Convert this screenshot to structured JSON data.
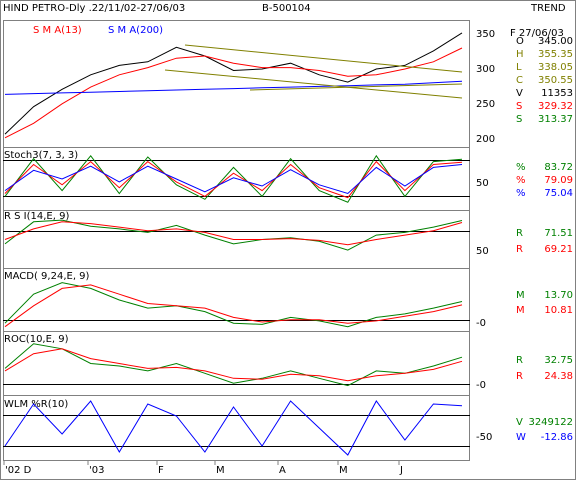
{
  "header": {
    "title": "HIND PETRO-Dly .22/11/02-27/06/03",
    "code": "B-500104",
    "trend_label": "TREND"
  },
  "price_panel": {
    "sma13_label": "S M A(13)",
    "sma200_label": "S M A(200)",
    "date_label": "F 27/06/03",
    "stats": [
      {
        "key": "O",
        "value": "345.00",
        "color": "#000000"
      },
      {
        "key": "H",
        "value": "355.35",
        "color": "#808000"
      },
      {
        "key": "L",
        "value": "338.05",
        "color": "#808000"
      },
      {
        "key": "C",
        "value": "350.55",
        "color": "#808000"
      },
      {
        "key": "V",
        "value": "11353",
        "color": "#000000"
      },
      {
        "key": "S",
        "value": "329.32",
        "color": "#ff0000"
      },
      {
        "key": "S",
        "value": "313.37",
        "color": "#008000"
      }
    ],
    "y_ticks": [
      "350",
      "300",
      "250",
      "200"
    ]
  },
  "stoch_panel": {
    "label": "Stoch3(7, 3, 3)",
    "stats": [
      {
        "key": "%",
        "value": "83.72",
        "color": "#008000"
      },
      {
        "key": "%",
        "value": "79.09",
        "color": "#ff0000"
      },
      {
        "key": "%",
        "value": "75.04",
        "color": "#0000ff"
      }
    ],
    "y_ticks": [
      "50"
    ]
  },
  "rsi_panel": {
    "label": "R S I(14,E, 9)",
    "stats": [
      {
        "key": "R",
        "value": "71.51",
        "color": "#008000"
      },
      {
        "key": "R",
        "value": "69.21",
        "color": "#ff0000"
      }
    ],
    "y_ticks": [
      "50"
    ]
  },
  "macd_panel": {
    "label": "MACD( 9,24,E, 9)",
    "stats": [
      {
        "key": "M",
        "value": "13.70",
        "color": "#008000"
      },
      {
        "key": "M",
        "value": "10.81",
        "color": "#ff0000"
      }
    ],
    "y_ticks": [
      "-0"
    ]
  },
  "roc_panel": {
    "label": "ROC(10,E, 9)",
    "stats": [
      {
        "key": "R",
        "value": "32.75",
        "color": "#008000"
      },
      {
        "key": "R",
        "value": "24.38",
        "color": "#ff0000"
      }
    ],
    "y_ticks": [
      "-0"
    ]
  },
  "wlm_panel": {
    "label": "WLM %R(10)",
    "stats": [
      {
        "key": "V",
        "value": "3249122",
        "color": "#008000"
      },
      {
        "key": "W",
        "value": "-12.86",
        "color": "#0000ff"
      }
    ],
    "y_ticks": [
      "-50"
    ]
  },
  "x_axis": {
    "labels": [
      "'02 D",
      "'03",
      "F",
      "M",
      "A",
      "M",
      "J"
    ]
  },
  "colors": {
    "price": "#000000",
    "sma13": "#ff0000",
    "sma200": "#0000ff",
    "trendline": "#808000",
    "indicator": "#008000",
    "signal": "#ff0000",
    "third": "#0000ff"
  },
  "chart_data": [
    {
      "type": "line",
      "title": "HIND PETRO-Dly .22/11/02-27/06/03",
      "x": [
        "2002-11-22",
        "2002-12-06",
        "2002-12-20",
        "2003-01-03",
        "2003-01-17",
        "2003-01-31",
        "2003-02-07",
        "2003-02-21",
        "2003-03-07",
        "2003-03-21",
        "2003-04-04",
        "2003-04-18",
        "2003-05-02",
        "2003-05-16",
        "2003-05-30",
        "2003-06-13",
        "2003-06-27"
      ],
      "ylim": [
        195,
        365
      ],
      "series": [
        {
          "name": "Price",
          "values": [
            210,
            248,
            272,
            292,
            305,
            310,
            330,
            318,
            298,
            300,
            308,
            292,
            282,
            300,
            305,
            325,
            350
          ]
        },
        {
          "name": "S M A(13)",
          "values": [
            205,
            225,
            252,
            275,
            292,
            302,
            315,
            318,
            308,
            302,
            302,
            298,
            290,
            292,
            300,
            310,
            329
          ]
        },
        {
          "name": "S M A(200)",
          "values": [
            265,
            266,
            267,
            268,
            269,
            270,
            271,
            272,
            273,
            274,
            275,
            276,
            277,
            278,
            279,
            281,
            283
          ]
        }
      ]
    },
    {
      "type": "line",
      "title": "Stoch3(7, 3, 3)",
      "x": [
        "2002-11-22",
        "2002-12-06",
        "2002-12-20",
        "2003-01-03",
        "2003-01-17",
        "2003-01-31",
        "2003-02-07",
        "2003-02-21",
        "2003-03-07",
        "2003-03-21",
        "2003-04-04",
        "2003-04-18",
        "2003-05-02",
        "2003-05-16",
        "2003-05-30",
        "2003-06-13",
        "2003-06-27"
      ],
      "ylim": [
        0,
        100
      ],
      "series": [
        {
          "name": "%",
          "values": [
            20,
            85,
            30,
            90,
            25,
            88,
            40,
            15,
            70,
            20,
            85,
            30,
            10,
            90,
            20,
            80,
            84
          ]
        },
        {
          "name": "%",
          "values": [
            25,
            75,
            40,
            80,
            35,
            80,
            45,
            20,
            60,
            30,
            75,
            35,
            18,
            80,
            30,
            75,
            79
          ]
        },
        {
          "name": "%",
          "values": [
            30,
            65,
            50,
            72,
            45,
            72,
            50,
            28,
            52,
            38,
            66,
            40,
            25,
            70,
            38,
            70,
            75
          ]
        }
      ]
    },
    {
      "type": "line",
      "title": "R S I(14,E, 9)",
      "x": [
        "2002-11-22",
        "2002-12-06",
        "2002-12-20",
        "2003-01-03",
        "2003-01-17",
        "2003-01-31",
        "2003-02-07",
        "2003-02-21",
        "2003-03-07",
        "2003-03-21",
        "2003-04-04",
        "2003-04-18",
        "2003-05-02",
        "2003-05-16",
        "2003-05-30",
        "2003-06-13",
        "2003-06-27"
      ],
      "ylim": [
        20,
        80
      ],
      "series": [
        {
          "name": "R",
          "values": [
            45,
            70,
            72,
            65,
            62,
            58,
            66,
            55,
            45,
            50,
            52,
            48,
            38,
            55,
            58,
            64,
            71.5
          ]
        },
        {
          "name": "R",
          "values": [
            50,
            62,
            70,
            68,
            64,
            60,
            62,
            58,
            50,
            50,
            51,
            49,
            44,
            50,
            55,
            60,
            69.2
          ]
        }
      ]
    },
    {
      "type": "line",
      "title": "MACD( 9,24,E, 9)",
      "x": [
        "2002-11-22",
        "2002-12-06",
        "2002-12-20",
        "2003-01-03",
        "2003-01-17",
        "2003-01-31",
        "2003-02-07",
        "2003-02-21",
        "2003-03-07",
        "2003-03-21",
        "2003-04-04",
        "2003-04-18",
        "2003-05-02",
        "2003-05-16",
        "2003-05-30",
        "2003-06-13",
        "2003-06-27"
      ],
      "ylim": [
        -10,
        40
      ],
      "series": [
        {
          "name": "M",
          "values": [
            -5,
            20,
            30,
            25,
            15,
            8,
            10,
            5,
            -5,
            -6,
            0,
            -3,
            -8,
            0,
            3,
            8,
            13.7
          ]
        },
        {
          "name": "M",
          "values": [
            -8,
            10,
            25,
            28,
            20,
            12,
            10,
            8,
            0,
            -4,
            -2,
            -2,
            -5,
            -3,
            1,
            5,
            10.8
          ]
        }
      ]
    },
    {
      "type": "line",
      "title": "ROC(10,E, 9)",
      "x": [
        "2002-11-22",
        "2002-12-06",
        "2002-12-20",
        "2003-01-03",
        "2003-01-17",
        "2003-01-31",
        "2003-02-07",
        "2003-02-21",
        "2003-03-07",
        "2003-03-21",
        "2003-04-04",
        "2003-04-18",
        "2003-05-02",
        "2003-05-16",
        "2003-05-30",
        "2003-06-13",
        "2003-06-27"
      ],
      "ylim": [
        -40,
        80
      ],
      "series": [
        {
          "name": "R",
          "values": [
            10,
            60,
            50,
            20,
            15,
            5,
            20,
            0,
            -20,
            -10,
            5,
            -10,
            -25,
            5,
            0,
            15,
            32.8
          ]
        },
        {
          "name": "R",
          "values": [
            5,
            40,
            50,
            30,
            20,
            10,
            12,
            5,
            -10,
            -12,
            -2,
            -5,
            -15,
            -5,
            0,
            8,
            24.4
          ]
        }
      ]
    },
    {
      "type": "line",
      "title": "WLM %R(10)",
      "x": [
        "2002-11-22",
        "2002-12-06",
        "2002-12-20",
        "2003-01-03",
        "2003-01-17",
        "2003-01-31",
        "2003-02-07",
        "2003-02-21",
        "2003-03-07",
        "2003-03-21",
        "2003-04-04",
        "2003-04-18",
        "2003-05-02",
        "2003-05-16",
        "2003-05-30",
        "2003-06-13",
        "2003-06-27"
      ],
      "ylim": [
        -100,
        0
      ],
      "series": [
        {
          "name": "W",
          "values": [
            -80,
            -10,
            -60,
            -5,
            -90,
            -10,
            -30,
            -90,
            -15,
            -80,
            -5,
            -50,
            -95,
            -5,
            -70,
            -10,
            -12.9
          ]
        }
      ]
    }
  ]
}
